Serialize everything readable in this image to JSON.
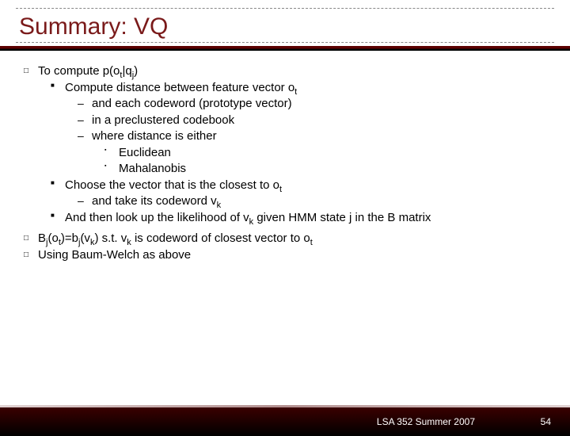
{
  "title": "Summary: VQ",
  "bullets": {
    "l1a_pre": "To compute p(o",
    "l1a_sub1": "t",
    "l1a_mid": "|q",
    "l1a_sub2": "j",
    "l1a_post": ")",
    "l2a_pre": "Compute distance between feature vector o",
    "l2a_sub": "t",
    "l3a": "and each codeword (prototype vector)",
    "l3b": "in a preclustered codebook",
    "l3c": "where distance is either",
    "l4a": "Euclidean",
    "l4b": "Mahalanobis",
    "l2b_pre": "Choose the vector that is the closest to o",
    "l2b_sub": "t",
    "l3d_pre": "and take its codeword v",
    "l3d_sub": "k",
    "l2c_pre": "And then look up the likelihood of v",
    "l2c_sub": "k",
    "l2c_post": " given HMM state j in the B matrix",
    "l1b_pre": "B",
    "l1b_s1": "j",
    "l1b_m1": "(o",
    "l1b_s2": "t",
    "l1b_m2": ")=b",
    "l1b_s3": "j",
    "l1b_m3": "(v",
    "l1b_s4": "k",
    "l1b_m4": ") s.t. v",
    "l1b_s5": "k",
    "l1b_m5": " is codeword of closest vector to o",
    "l1b_s6": "t",
    "l1c": "Using Baum-Welch as above"
  },
  "footer": {
    "course": "LSA 352 Summer 2007",
    "page": "54"
  }
}
